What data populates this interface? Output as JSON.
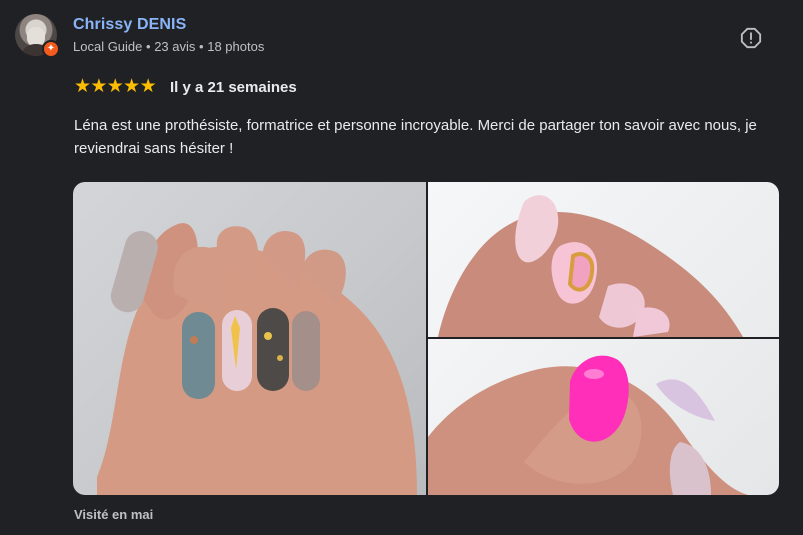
{
  "reviewer": {
    "name": "Chrissy DENIS",
    "level": "Local Guide",
    "separator": "•",
    "reviews": "23 avis",
    "photos": "18 photos"
  },
  "review": {
    "stars": 5,
    "time": "Il y a 21 semaines",
    "text": "Léna est une prothésiste, formatrice et personne incroyable. Merci de partager ton savoir avec nous, je reviendrai sans hésiter !",
    "visited": "Visité en mai"
  },
  "icons": {
    "avatar": "user-avatar",
    "badge": "local-guide-badge",
    "report": "report-icon",
    "star": "star-icon"
  },
  "colors": {
    "background": "#202124",
    "name": "#8ab4f8",
    "star": "#fbbc04",
    "secondary_text": "#bdc1c6",
    "badge": "#f25b1d"
  }
}
